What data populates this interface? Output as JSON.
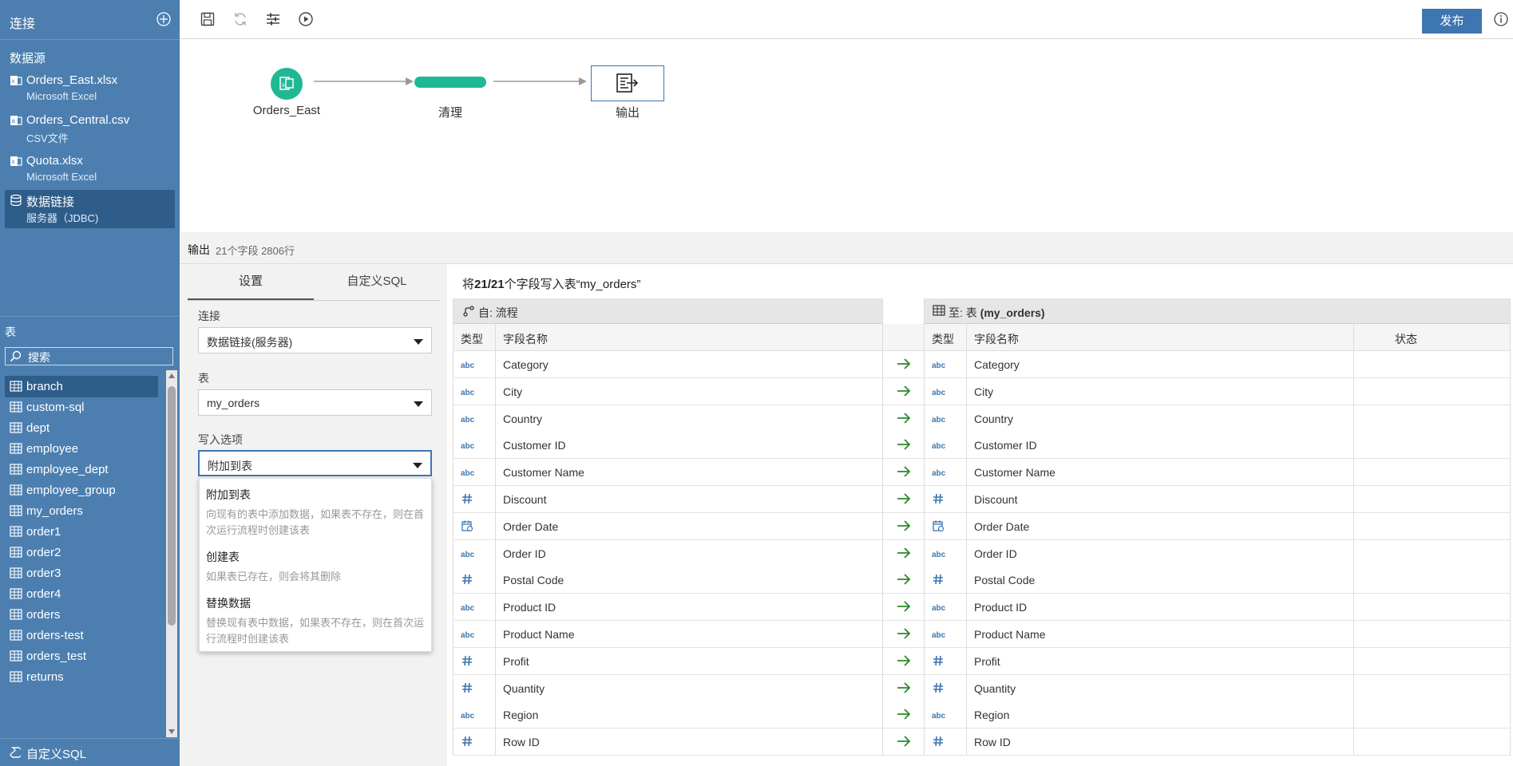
{
  "sidebar": {
    "title": "连接",
    "datasource_label": "数据源",
    "datasources": [
      {
        "name": "Orders_East.xlsx",
        "sub": "Microsoft Excel",
        "icon": "excel-file-icon"
      },
      {
        "name": "Orders_Central.csv",
        "sub": "CSV文件",
        "icon": "csv-file-icon"
      },
      {
        "name": "Quota.xlsx",
        "sub": "Microsoft Excel",
        "icon": "excel-file-icon"
      },
      {
        "name": "数据链接",
        "sub": "服务器（JDBC)",
        "icon": "database-icon",
        "active": true
      }
    ],
    "tables_label": "表",
    "search_placeholder": "搜索",
    "tables": [
      "branch",
      "custom-sql",
      "dept",
      "employee",
      "employee_dept",
      "employee_group",
      "my_orders",
      "order1",
      "order2",
      "order3",
      "order4",
      "orders",
      "orders-test",
      "orders_test",
      "returns"
    ],
    "active_table": "branch",
    "custom_sql_label": "自定义SQL"
  },
  "toolbar": {
    "publish_label": "发布"
  },
  "flow": {
    "nodes": [
      {
        "label": "Orders_East"
      },
      {
        "label": "清理"
      },
      {
        "label": "输出"
      }
    ]
  },
  "panel": {
    "title": "输出",
    "stats": "21个字段  2806行"
  },
  "settings": {
    "tabs": [
      "设置",
      "自定义SQL"
    ],
    "active_tab": "设置",
    "connection_label": "连接",
    "connection_value": "数据链接(服务器)",
    "table_label": "表",
    "table_value": "my_orders",
    "write_label": "写入选项",
    "write_value": "附加到表",
    "write_options": [
      {
        "title": "附加到表",
        "desc": "向现有的表中添加数据，如果表不存在，则在首次运行流程时创建该表"
      },
      {
        "title": "创建表",
        "desc": "如果表已存在，则会将其删除"
      },
      {
        "title": "替换数据",
        "desc": "替换现有表中数据，如果表不存在，则在首次运行流程时创建该表"
      }
    ]
  },
  "mapping": {
    "title_prefix": "将",
    "title_count": "21/21",
    "title_suffix": "个字段写入表“my_orders”",
    "from_header": "自: 流程",
    "to_header_prefix": "至: 表",
    "to_header_table": "(my_orders)",
    "col_type": "类型",
    "col_field": "字段名称",
    "col_status": "状态",
    "rows": [
      {
        "type": "abc",
        "field": "Category"
      },
      {
        "type": "abc",
        "field": "City"
      },
      {
        "type": "abc",
        "field": "Country"
      },
      {
        "type": "abc",
        "field": "Customer ID"
      },
      {
        "type": "abc",
        "field": "Customer Name"
      },
      {
        "type": "#",
        "field": "Discount"
      },
      {
        "type": "date",
        "field": "Order Date"
      },
      {
        "type": "abc",
        "field": "Order ID"
      },
      {
        "type": "#",
        "field": "Postal Code"
      },
      {
        "type": "abc",
        "field": "Product ID"
      },
      {
        "type": "abc",
        "field": "Product Name"
      },
      {
        "type": "#",
        "field": "Profit"
      },
      {
        "type": "#",
        "field": "Quantity"
      },
      {
        "type": "abc",
        "field": "Region"
      },
      {
        "type": "#",
        "field": "Row ID"
      }
    ]
  },
  "colors": {
    "sidebar": "#4c7fb0",
    "sidebar_active": "#2e5d8a",
    "accent": "#3d76b0",
    "flow_green": "#1fb895",
    "arrow_green": "#2a8a2a"
  }
}
